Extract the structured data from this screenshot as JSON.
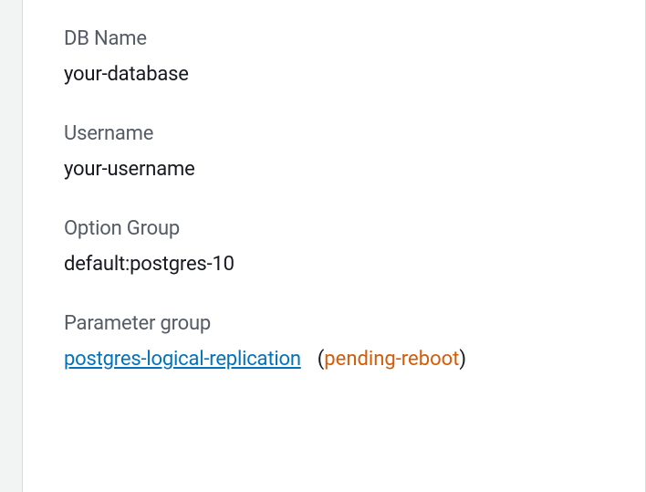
{
  "fields": {
    "dbName": {
      "label": "DB Name",
      "value": "your-database"
    },
    "username": {
      "label": "Username",
      "value": "your-username"
    },
    "optionGroup": {
      "label": "Option Group",
      "value": "default:postgres-10"
    },
    "parameterGroup": {
      "label": "Parameter group",
      "linkValue": "postgres-logical-replication",
      "status": "pending-reboot"
    }
  }
}
